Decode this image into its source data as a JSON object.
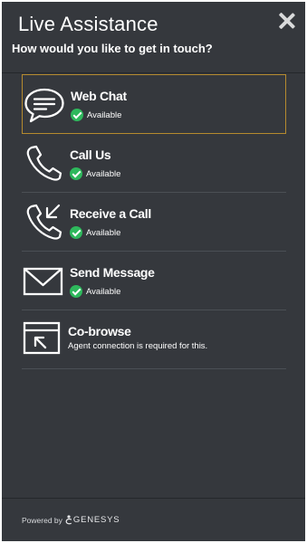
{
  "header": {
    "title": "Live Assistance",
    "subtitle": "How would you like to get in touch?",
    "close_icon": "close-icon"
  },
  "options": [
    {
      "name": "Web Chat",
      "status": "Available",
      "icon": "chat-bubble-icon",
      "focused": true
    },
    {
      "name": "Call Us",
      "status": "Available",
      "icon": "phone-icon"
    },
    {
      "name": "Receive a Call",
      "status": "Available",
      "icon": "phone-incoming-icon"
    },
    {
      "name": "Send Message",
      "status": "Available",
      "icon": "envelope-icon"
    },
    {
      "name": "Co-browse",
      "note": "Agent connection is required for this.",
      "icon": "cobrowse-icon"
    }
  ],
  "footer": {
    "powered_by": "Powered by",
    "brand": "GENESYS"
  },
  "colors": {
    "panel_background": "#35383d",
    "available_check": "#2eb85c",
    "focus_border": "#b58a2e"
  }
}
